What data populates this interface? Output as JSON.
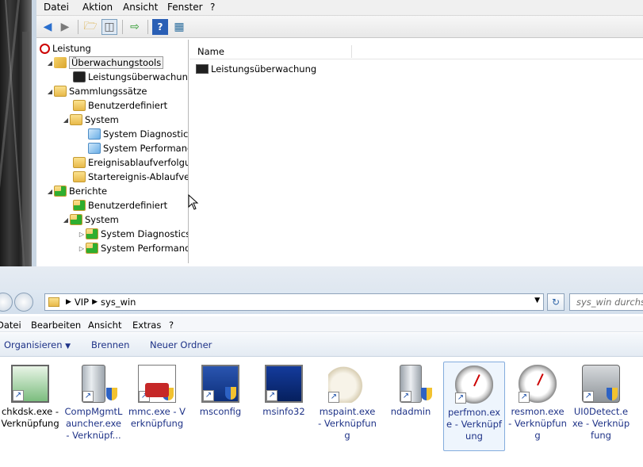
{
  "mmc": {
    "menu": [
      "Datei",
      "Aktion",
      "Ansicht",
      "Fenster",
      "?"
    ],
    "toolbar_icons": [
      "back-icon",
      "forward-icon",
      "up-folder-icon",
      "show-hide-tree-icon",
      "export-list-icon",
      "help-icon",
      "properties-icon"
    ],
    "tree": [
      {
        "label": "Leistung",
        "icon": "performance-icon",
        "level": 0
      },
      {
        "label": "Überwachungstools",
        "icon": "tools-icon",
        "level": 1,
        "expanded": true,
        "selected": true
      },
      {
        "label": "Leistungsüberwachung",
        "icon": "monitor-icon",
        "level": 2
      },
      {
        "label": "Sammlungssätze",
        "icon": "folder-icon",
        "level": 1,
        "expanded": true
      },
      {
        "label": "Benutzerdefiniert",
        "icon": "user-folder-icon",
        "level": 2
      },
      {
        "label": "System",
        "icon": "folder-icon",
        "level": 2,
        "expanded": true
      },
      {
        "label": "System Diagnostics",
        "icon": "cube-icon",
        "level": 3
      },
      {
        "label": "System Performanc",
        "icon": "cube-icon",
        "level": 3
      },
      {
        "label": "Ereignisablaufverfolgur",
        "icon": "folder-icon",
        "level": 2
      },
      {
        "label": "Startereignis-Ablaufver",
        "icon": "folder-icon",
        "level": 2
      },
      {
        "label": "Berichte",
        "icon": "report-icon",
        "level": 1,
        "expanded": true
      },
      {
        "label": "Benutzerdefiniert",
        "icon": "report-icon",
        "level": 2
      },
      {
        "label": "System",
        "icon": "report-icon",
        "level": 2,
        "expanded": true
      },
      {
        "label": "System Diagnostics",
        "icon": "report-icon",
        "level": 3,
        "collapsed": true
      },
      {
        "label": "System Performanc",
        "icon": "report-icon",
        "level": 3,
        "collapsed": true
      }
    ],
    "list_header": "Name",
    "list_items": [
      "Leistungsüberwachung"
    ]
  },
  "explorer": {
    "breadcrumb": [
      "VIP",
      "sys_win"
    ],
    "search_placeholder": "sys_win durchsu",
    "menu": [
      "Datei",
      "Bearbeiten",
      "Ansicht",
      "Extras",
      "?"
    ],
    "commands": {
      "organize": "Organisieren",
      "burn": "Brennen",
      "new_folder": "Neuer Ordner"
    },
    "files": [
      {
        "name": "chkdsk.exe - Verknüpfung",
        "icon": "chkdsk-icon"
      },
      {
        "name": "CompMgmtLauncher.exe - Verknüpf...",
        "icon": "computer-management-icon"
      },
      {
        "name": "mmc.exe - Verknüpfung",
        "icon": "mmc-icon"
      },
      {
        "name": "msconfig",
        "icon": "msconfig-icon"
      },
      {
        "name": "msinfo32",
        "icon": "msinfo-icon"
      },
      {
        "name": "mspaint.exe - Verknüpfung",
        "icon": "paint-icon"
      },
      {
        "name": "ndadmin",
        "icon": "ndadmin-icon"
      },
      {
        "name": "perfmon.exe - Verknüpfung",
        "icon": "perfmon-icon",
        "selected": true
      },
      {
        "name": "resmon.exe - Verknüpfung",
        "icon": "resmon-icon"
      },
      {
        "name": "UI0Detect.exe - Verknüpfung",
        "icon": "ui0detect-icon"
      }
    ]
  }
}
